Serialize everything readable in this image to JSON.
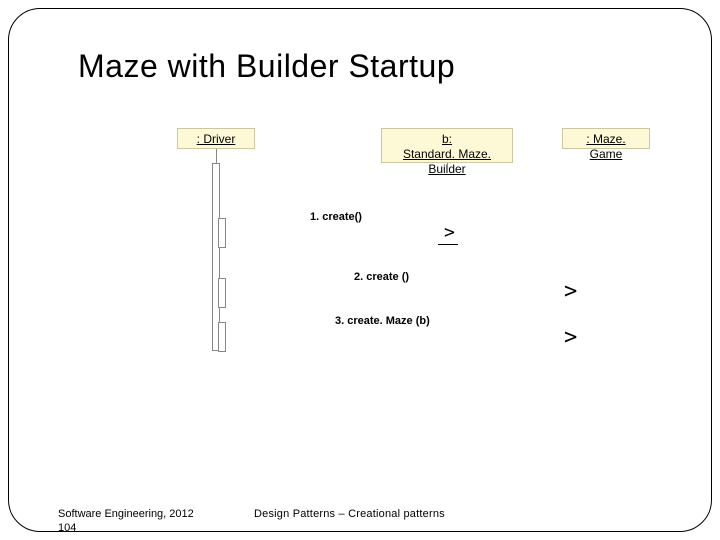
{
  "title": "Maze with Builder Startup",
  "lifelines": {
    "driver": {
      "label": ": Driver"
    },
    "builder": {
      "line1": "b:",
      "line2": "Standard. Maze. Builder"
    },
    "mazegame": {
      "label": ": Maze. Game"
    }
  },
  "messages": {
    "m1": "1. create()",
    "m2": "2. create ()",
    "m3": "3. create. Maze (b)"
  },
  "arrows": {
    "sym": ">"
  },
  "footer": {
    "left": "Software Engineering, 2012",
    "page": "104",
    "center": "Design Patterns – Creational patterns"
  }
}
